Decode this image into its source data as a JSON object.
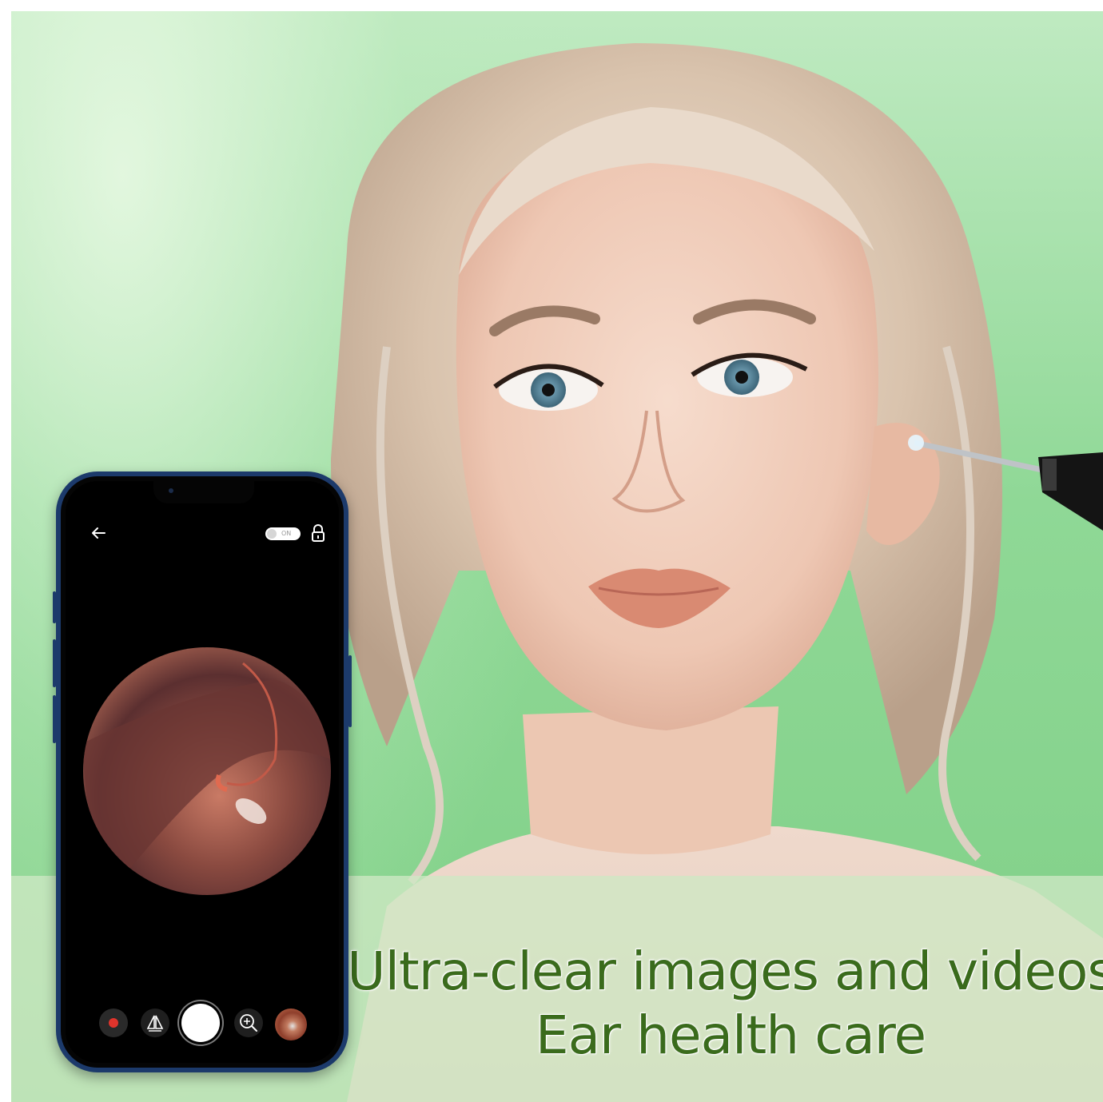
{
  "headline": {
    "line1": "Ultra-clear images and videos",
    "line2": "Ear health care",
    "color": "#3a6b1c"
  },
  "background": {
    "accent": "#8fd896"
  },
  "phone": {
    "frame_color": "#1c3a6b",
    "toggle_label": "ON",
    "icons": [
      "back-arrow-icon",
      "lock-icon",
      "record-icon",
      "mirror-icon",
      "shutter-button",
      "zoom-in-icon",
      "gallery-thumbnail"
    ]
  }
}
